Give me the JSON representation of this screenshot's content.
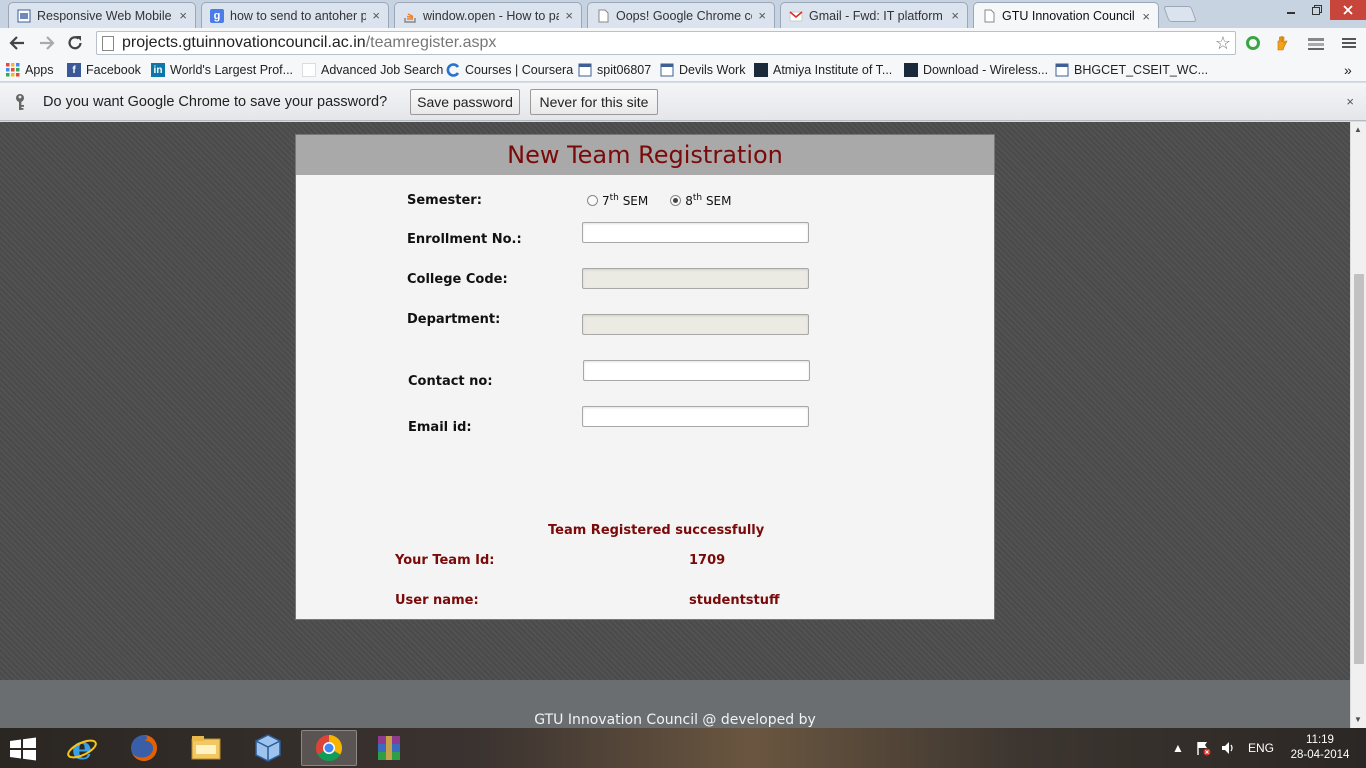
{
  "browser": {
    "tabs": [
      {
        "title": "Responsive Web Mobile -",
        "icon": "page-favicon-icon",
        "active": false
      },
      {
        "title": "how to send to antoher pa",
        "icon": "google-favicon-icon",
        "active": false
      },
      {
        "title": "window.open - How to pa",
        "icon": "stackoverflow-favicon-icon",
        "active": false
      },
      {
        "title": "Oops! Google Chrome cou",
        "icon": "document-favicon-icon",
        "active": false
      },
      {
        "title": "Gmail - Fwd: IT platform a",
        "icon": "gmail-favicon-icon",
        "active": false
      },
      {
        "title": "GTU Innovation Council",
        "icon": "document-favicon-icon",
        "active": true
      }
    ],
    "close_glyph": "×",
    "address": {
      "host": "projects.gtuinnovationcouncil.ac.in",
      "path": "/teamregister.aspx"
    },
    "bookmarks": [
      {
        "label": "Apps",
        "icon": "apps-grid-icon"
      },
      {
        "label": "Facebook",
        "icon": "facebook-icon"
      },
      {
        "label": "World's Largest Prof...",
        "icon": "linkedin-icon"
      },
      {
        "label": "Advanced Job Search",
        "icon": "blank-page-icon"
      },
      {
        "label": "Courses | Coursera",
        "icon": "coursera-icon"
      },
      {
        "label": "spit06807",
        "icon": "page-favicon-icon"
      },
      {
        "label": "Devils Work",
        "icon": "page-favicon-icon"
      },
      {
        "label": "Atmiya Institute of T...",
        "icon": "dark-site-icon"
      },
      {
        "label": "Download - Wireless...",
        "icon": "dark-site-icon"
      },
      {
        "label": "BHGCET_CSEIT_WC...",
        "icon": "page-favicon-icon"
      }
    ],
    "bookmarks_overflow": "»"
  },
  "infobar": {
    "message": "Do you want Google Chrome to save your password?",
    "save_label": "Save password",
    "never_label": "Never for this site",
    "close_glyph": "×"
  },
  "form": {
    "title": "New Team Registration",
    "semester_label": "Semester:",
    "semester_options": [
      {
        "num": "7",
        "sup": "th",
        "suffix": " SEM",
        "checked": false
      },
      {
        "num": "8",
        "sup": "th",
        "suffix": " SEM",
        "checked": true
      }
    ],
    "enrollment_label": "Enrollment No.:",
    "enrollment_value": "",
    "college_code_label": "College Code:",
    "college_code_value": "",
    "department_label": "Department:",
    "department_value": "",
    "contact_label": "Contact no:",
    "contact_value": "",
    "email_label": "Email id:",
    "email_value": "",
    "success_message": "Team Registered successfully",
    "team_id_label": "Your Team Id:",
    "team_id_value": "1709",
    "username_label": "User name:",
    "username_value": "studentstuff"
  },
  "footer": {
    "text": "GTU Innovation Council @ developed by"
  },
  "taskbar": {
    "apps": [
      {
        "name": "internet-explorer-icon",
        "active": false
      },
      {
        "name": "firefox-icon",
        "active": false
      },
      {
        "name": "file-explorer-icon",
        "active": false
      },
      {
        "name": "virtualbox-icon",
        "active": false
      },
      {
        "name": "chrome-icon",
        "active": true
      },
      {
        "name": "winrar-icon",
        "active": false
      }
    ],
    "language": "ENG",
    "time": "11:19",
    "date": "28-04-2014"
  },
  "colors": {
    "accent_maroon": "#7a0a0a",
    "panel_header": "#a9a9a9",
    "page_background": "#4d4d4d"
  }
}
